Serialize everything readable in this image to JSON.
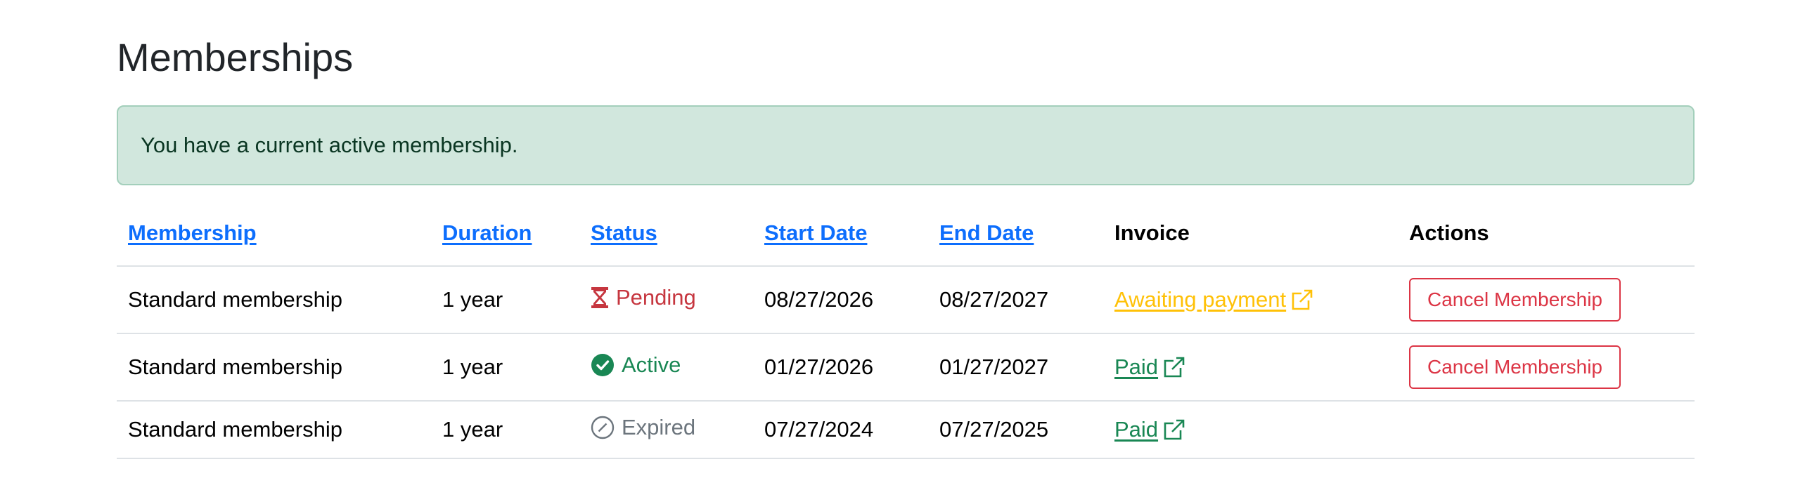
{
  "page": {
    "title": "Memberships"
  },
  "alert": {
    "message": "You have a current active membership."
  },
  "table": {
    "headers": {
      "membership": "Membership",
      "duration": "Duration",
      "status": "Status",
      "start_date": "Start Date",
      "end_date": "End Date",
      "invoice": "Invoice",
      "actions": "Actions"
    },
    "rows": [
      {
        "membership": "Standard membership",
        "duration": "1 year",
        "status": "Pending",
        "status_icon": "hourglass-icon",
        "start_date": "08/27/2026",
        "end_date": "08/27/2027",
        "invoice": "Awaiting payment",
        "action": "Cancel Membership"
      },
      {
        "membership": "Standard membership",
        "duration": "1 year",
        "status": "Active",
        "status_icon": "check-circle-icon",
        "start_date": "01/27/2026",
        "end_date": "01/27/2027",
        "invoice": "Paid",
        "action": "Cancel Membership"
      },
      {
        "membership": "Standard membership",
        "duration": "1 year",
        "status": "Expired",
        "status_icon": "slash-circle-icon",
        "start_date": "07/27/2024",
        "end_date": "07/27/2025",
        "invoice": "Paid",
        "action": ""
      }
    ]
  },
  "colors": {
    "link": "#0d6efd",
    "alert_bg": "#d1e7dd",
    "alert_border": "#a3cfbb",
    "alert_text": "#0a3622",
    "pending": "#c6363f",
    "active": "#198754",
    "expired": "#6c757d",
    "awaiting_payment": "#ffc107",
    "paid": "#198754",
    "danger": "#dc3545"
  }
}
